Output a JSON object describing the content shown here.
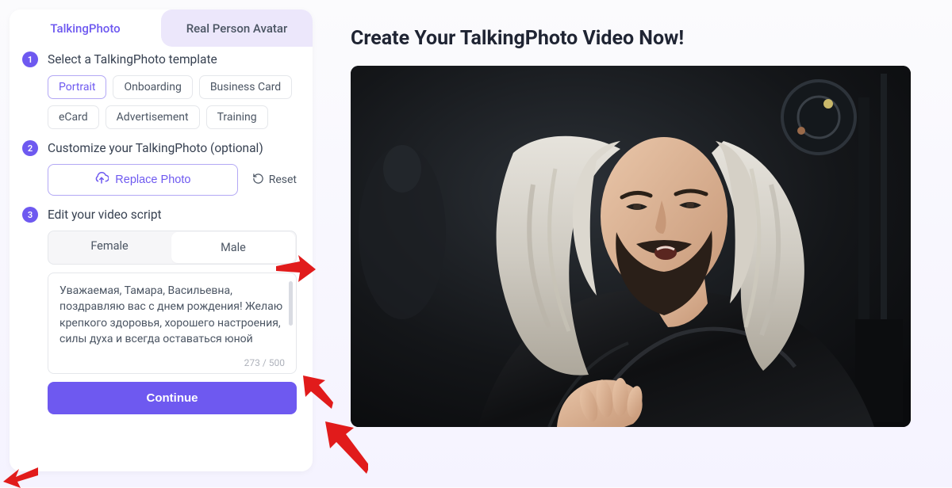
{
  "tabs": {
    "talking_photo": "TalkingPhoto",
    "real_person": "Real Person Avatar"
  },
  "step1": {
    "num": "1",
    "title": "Select a TalkingPhoto template",
    "chips": [
      "Portrait",
      "Onboarding",
      "Business Card",
      "eCard",
      "Advertisement",
      "Training"
    ],
    "selected": "Portrait"
  },
  "step2": {
    "num": "2",
    "title": "Customize your TalkingPhoto (optional)",
    "replace": "Replace Photo",
    "reset": "Reset"
  },
  "step3": {
    "num": "3",
    "title": "Edit your video script",
    "female": "Female",
    "male": "Male",
    "selected": "Male",
    "script": "Уважаемая, Тамара, Васильевна, поздравляю вас с днем рождения! Желаю крепкого здоровья, хорошего настроения, силы духа и всегда оставаться юной душой.",
    "counter": "273 / 500",
    "continue": "Continue"
  },
  "hero": {
    "title": "Create Your TalkingPhoto Video Now!"
  }
}
